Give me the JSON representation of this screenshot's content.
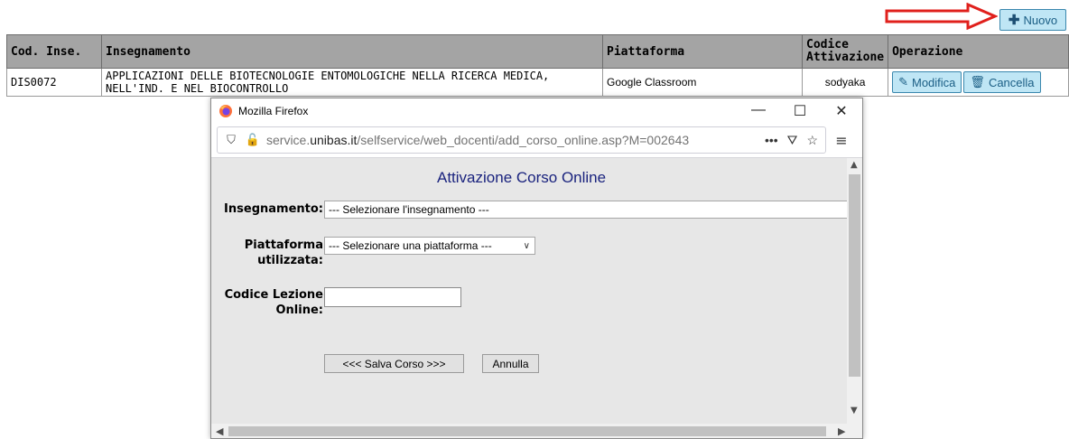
{
  "toolbar": {
    "new_label": "Nuovo"
  },
  "table": {
    "headers": {
      "cod": "Cod. Inse.",
      "ins": "Insegnamento",
      "pia": "Piattaforma",
      "act1": "Codice",
      "act2": "Attivazione",
      "op": "Operazione"
    },
    "rows": [
      {
        "cod": "DIS0072",
        "ins1": "APPLICAZIONI DELLE BIOTECNOLOGIE ENTOMOLOGICHE NELLA RICERCA MEDICA,",
        "ins2": "NELL'IND. E NEL BIOCONTROLLO",
        "pia": "Google Classroom",
        "code": "sodyaka",
        "edit": "Modifica",
        "delete": "Cancella"
      }
    ]
  },
  "popup": {
    "window_title": "Mozilla Firefox",
    "url_plain": "service.",
    "url_domain": "unibas.it",
    "url_path": "/selfservice/web_docenti/add_corso_online.asp?M=002643",
    "form": {
      "title": "Attivazione Corso Online",
      "ins_label": "Insegnamento:",
      "ins_value": "--- Selezionare l'insegnamento ---",
      "pia_label1": "Piattaforma",
      "pia_label2": "utilizzata:",
      "pia_value": "--- Selezionare una piattaforma ---",
      "cod_label1": "Codice Lezione",
      "cod_label2": "Online:",
      "cod_value": "",
      "save_label": "<<< Salva Corso >>>",
      "cancel_label": "Annulla"
    }
  },
  "colors": {
    "arrow": "#e0201c",
    "button_bg": "#bfe6f5",
    "header_bg": "#a4a4a4",
    "form_title": "#1a237e"
  }
}
